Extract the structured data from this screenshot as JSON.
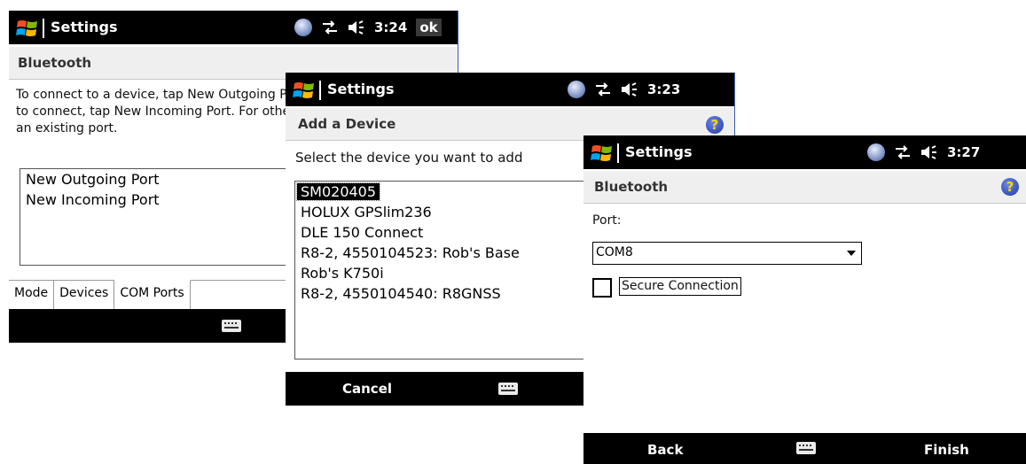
{
  "windows": {
    "bluetooth": {
      "title": "Settings",
      "time": "3:24",
      "ok_label": "ok",
      "header": "Bluetooth",
      "description": "To connect to a device, tap New Outgoing Port. To allow other devices to connect, tap New Incoming Port. For other options, tap and hold an existing port.",
      "ports": [
        "New Outgoing Port",
        "New Incoming Port"
      ],
      "tabs": [
        "Mode",
        "Devices",
        "COM Ports"
      ],
      "active_tab": "COM Ports"
    },
    "add_device": {
      "title": "Settings",
      "time": "3:23",
      "header": "Add a Device",
      "instruction": "Select the device you want to add",
      "devices": [
        "SM020405",
        "HOLUX GPSlim236",
        "DLE 150 Connect",
        "R8-2, 4550104523: Rob's Base",
        "Rob's K750i",
        "R8-2, 4550104540: R8GNSS"
      ],
      "selected_device": "SM020405",
      "left_softkey": "Cancel"
    },
    "port": {
      "title": "Settings",
      "time": "3:27",
      "header": "Bluetooth",
      "port_label": "Port:",
      "port_value": "COM8",
      "secure_label": "Secure Connection",
      "secure_checked": false,
      "left_softkey": "Back",
      "right_softkey": "Finish"
    }
  },
  "icons": {
    "start": "windows-flag-icon",
    "bluetooth": "bluetooth-icon",
    "connectivity": "connectivity-arrows-icon",
    "volume": "speaker-volume-icon",
    "help": "help-icon",
    "keyboard": "keyboard-icon"
  },
  "colors": {
    "titlebar": "#000000",
    "header_bg": "#efefef",
    "selection": "#000000",
    "help": "#2038a8"
  }
}
